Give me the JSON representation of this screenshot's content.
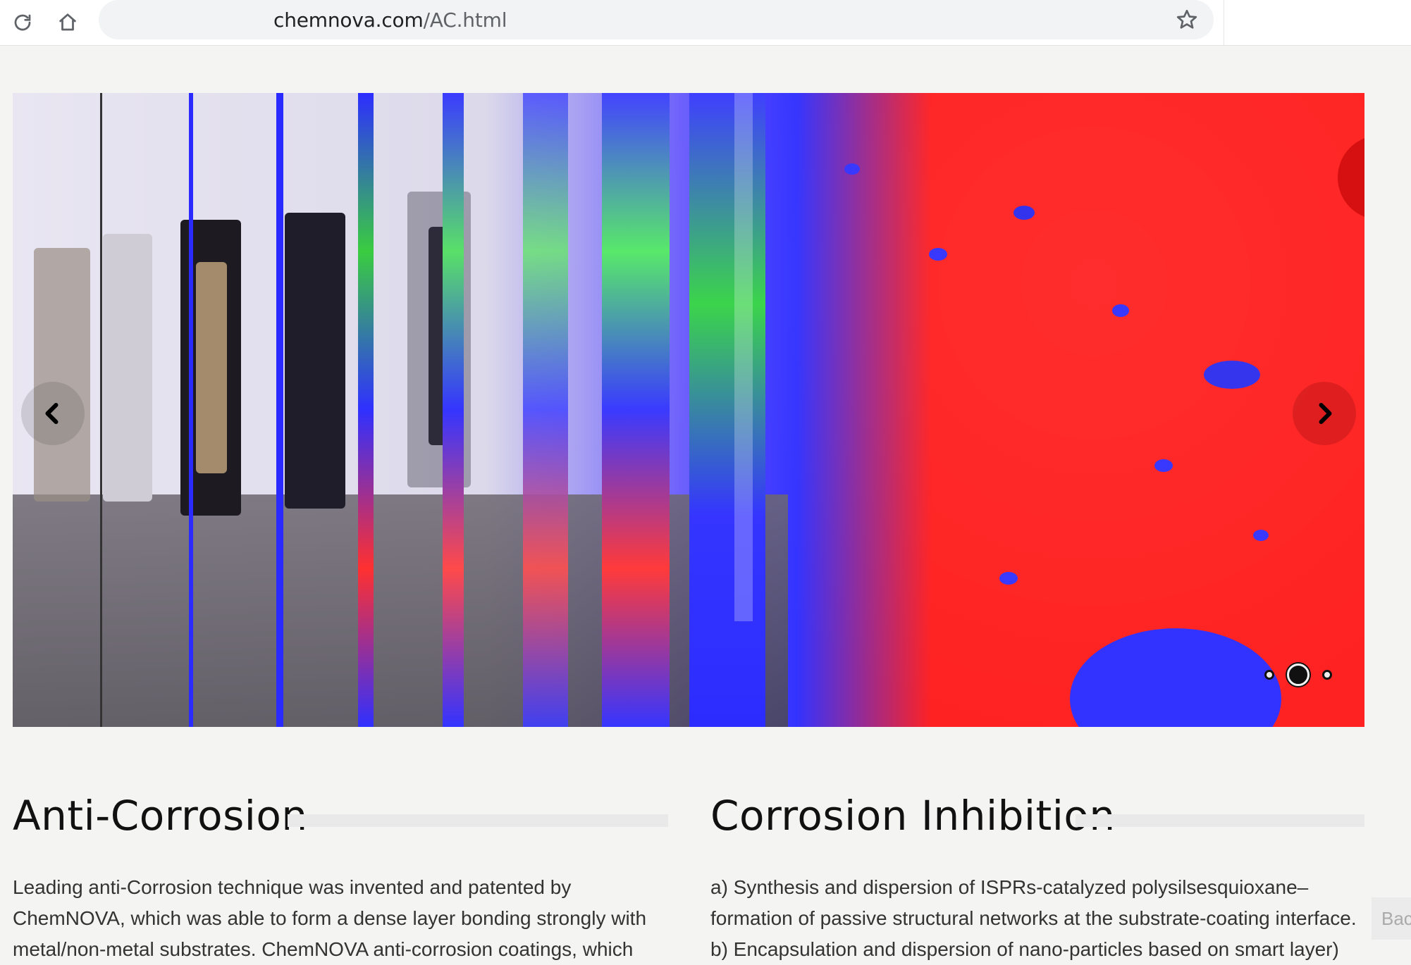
{
  "browser": {
    "url_host": "chemnova.com",
    "url_path": "/AC.html"
  },
  "slider": {
    "slide_count": 3,
    "active_slide": 2
  },
  "sections": [
    {
      "title": "Anti-Corrosion",
      "lines": [
        "Leading anti-Corrosion technique was invented and patented by",
        "ChemNOVA, which was able to form a dense layer bonding strongly with",
        "metal/non-metal substrates. ChemNOVA anti-corrosion coatings, which"
      ]
    },
    {
      "title": "Corrosion Inhibition",
      "lines": [
        "a) Synthesis and dispersion of ISPRs-catalyzed polysilsesquioxane–",
        "formation of passive structural networks at the substrate-coating interface.",
        "b) Encapsulation and dispersion of nano-particles based on smart layer)"
      ]
    }
  ],
  "back_button": {
    "label": "Back"
  },
  "colors": {
    "page_bg": "#f4f4f3",
    "title_text": "#111111",
    "body_text": "#333333",
    "rule": "#e9e9e9"
  }
}
